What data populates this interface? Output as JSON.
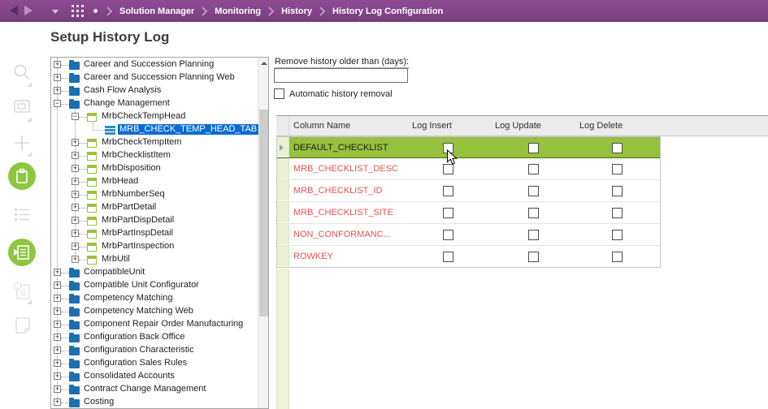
{
  "topbar": {
    "breadcrumb": [
      "Solution Manager",
      "Monitoring",
      "History",
      "History Log Configuration"
    ]
  },
  "sidebar": {
    "icons": [
      "search",
      "comment",
      "add",
      "clipboard",
      "checklist",
      "document-navigator",
      "info-document",
      "note"
    ]
  },
  "page": {
    "title": "Setup History Log"
  },
  "tree": {
    "items": [
      {
        "label": "Career and Succession Planning",
        "level": 0,
        "icon": "folder",
        "expander": "plus",
        "selected": false
      },
      {
        "label": "Career and Succession Planning Web",
        "level": 0,
        "icon": "folder",
        "expander": "plus",
        "selected": false
      },
      {
        "label": "Cash Flow Analysis",
        "level": 0,
        "icon": "folder",
        "expander": "plus",
        "selected": false
      },
      {
        "label": "Change Management",
        "level": 0,
        "icon": "folder",
        "expander": "minus",
        "selected": false
      },
      {
        "label": "MrbCheckTempHead",
        "level": 1,
        "icon": "form",
        "expander": "minus",
        "selected": false
      },
      {
        "label": "MRB_CHECK_TEMP_HEAD_TAB",
        "level": 2,
        "icon": "table",
        "expander": "none",
        "selected": true
      },
      {
        "label": "MrbCheckTempItem",
        "level": 1,
        "icon": "form",
        "expander": "plus",
        "selected": false
      },
      {
        "label": "MrbChecklistItem",
        "level": 1,
        "icon": "form",
        "expander": "plus",
        "selected": false
      },
      {
        "label": "MrbDisposition",
        "level": 1,
        "icon": "form",
        "expander": "plus",
        "selected": false
      },
      {
        "label": "MrbHead",
        "level": 1,
        "icon": "form",
        "expander": "plus",
        "selected": false
      },
      {
        "label": "MrbNumberSeq",
        "level": 1,
        "icon": "form",
        "expander": "plus",
        "selected": false
      },
      {
        "label": "MrbPartDetail",
        "level": 1,
        "icon": "form",
        "expander": "plus",
        "selected": false
      },
      {
        "label": "MrbPartDispDetail",
        "level": 1,
        "icon": "form",
        "expander": "plus",
        "selected": false
      },
      {
        "label": "MrbPartInspDetail",
        "level": 1,
        "icon": "form",
        "expander": "plus",
        "selected": false
      },
      {
        "label": "MrbPartInspection",
        "level": 1,
        "icon": "form",
        "expander": "plus",
        "selected": false
      },
      {
        "label": "MrbUtil",
        "level": 1,
        "icon": "form",
        "expander": "plus",
        "selected": false
      },
      {
        "label": "CompatibleUnit",
        "level": 0,
        "icon": "folder",
        "expander": "plus",
        "selected": false
      },
      {
        "label": "Compatible Unit Configurator",
        "level": 0,
        "icon": "folder",
        "expander": "plus",
        "selected": false
      },
      {
        "label": "Competency Matching",
        "level": 0,
        "icon": "folder",
        "expander": "plus",
        "selected": false
      },
      {
        "label": "Competency Matching Web",
        "level": 0,
        "icon": "folder",
        "expander": "plus",
        "selected": false
      },
      {
        "label": "Component Repair Order Manufacturing",
        "level": 0,
        "icon": "folder",
        "expander": "plus",
        "selected": false
      },
      {
        "label": "Configuration Back Office",
        "level": 0,
        "icon": "folder",
        "expander": "plus",
        "selected": false
      },
      {
        "label": "Configuration Characteristic",
        "level": 0,
        "icon": "folder",
        "expander": "plus",
        "selected": false
      },
      {
        "label": "Configuration Sales Rules",
        "level": 0,
        "icon": "folder",
        "expander": "plus",
        "selected": false
      },
      {
        "label": "Consolidated Accounts",
        "level": 0,
        "icon": "folder",
        "expander": "plus",
        "selected": false
      },
      {
        "label": "Contract Change Management",
        "level": 0,
        "icon": "folder",
        "expander": "plus",
        "selected": false
      },
      {
        "label": "Costing",
        "level": 0,
        "icon": "folder",
        "expander": "plus",
        "selected": false
      }
    ]
  },
  "settings": {
    "remove_label": "Remove history older than (days):",
    "remove_value": "",
    "auto_label": "Automatic history removal",
    "auto_checked": false
  },
  "grid": {
    "columns": [
      "Column Name",
      "Log Insert",
      "Log Update",
      "Log Delete"
    ],
    "rows": [
      {
        "name": "DEFAULT_CHECKLIST",
        "selected": true,
        "log_insert": false,
        "log_update": false,
        "log_delete": false
      },
      {
        "name": "MRB_CHECKLIST_DESC",
        "selected": false,
        "log_insert": false,
        "log_update": false,
        "log_delete": false
      },
      {
        "name": "MRB_CHECKLIST_ID",
        "selected": false,
        "log_insert": false,
        "log_update": false,
        "log_delete": false
      },
      {
        "name": "MRB_CHECKLIST_SITE",
        "selected": false,
        "log_insert": false,
        "log_update": false,
        "log_delete": false
      },
      {
        "name": "NON_CONFORMANC...",
        "selected": false,
        "log_insert": false,
        "log_update": false,
        "log_delete": false
      },
      {
        "name": "ROWKEY",
        "selected": false,
        "log_insert": false,
        "log_update": false,
        "log_delete": false
      }
    ]
  },
  "colors": {
    "topbar_purple": "#83458a",
    "accent_green": "#8dc63f",
    "selected_row_green": "#96c13c",
    "selected_node_blue": "#0c6cd2",
    "column_red": "#e2554d",
    "gutter_green": "#e9f1d4"
  }
}
